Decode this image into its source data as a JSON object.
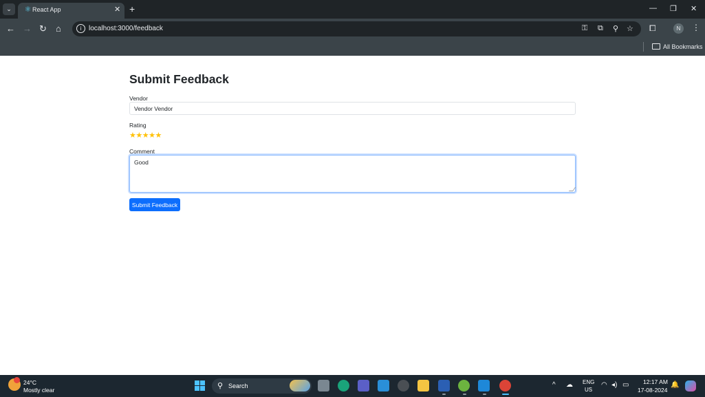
{
  "browser": {
    "tab_title": "React App",
    "url": "localhost:3000/feedback",
    "bookmarks_label": "All Bookmarks",
    "profile_initial": "N"
  },
  "page": {
    "title": "Submit Feedback",
    "vendor_label": "Vendor",
    "vendor_value": "Vendor Vendor",
    "rating_label": "Rating",
    "rating_value": 5,
    "rating_max": 5,
    "rating_color": "#ffc107",
    "comment_label": "Comment",
    "comment_value": "Good",
    "submit_label": "Submit Feedback",
    "accent_color": "#0d6efd"
  },
  "taskbar": {
    "weather_temp": "24°C",
    "weather_desc": "Mostly clear",
    "search_label": "Search",
    "lang_line1": "ENG",
    "lang_line2": "US",
    "time": "12:17 AM",
    "date": "17-08-2024"
  },
  "icons": [
    "tab-search-icon",
    "react-favicon",
    "close-icon",
    "plus-icon",
    "minimize-icon",
    "restore-icon",
    "back-icon",
    "forward-icon",
    "reload-icon",
    "home-icon",
    "site-info-icon",
    "password-key-icon",
    "install-app-icon",
    "zoom-icon",
    "bookmark-star-icon",
    "extensions-icon",
    "menu-icon",
    "folder-icon",
    "windows-start-icon",
    "search-icon",
    "wifi-icon",
    "volume-icon",
    "battery-icon",
    "notification-icon",
    "copilot-icon"
  ]
}
